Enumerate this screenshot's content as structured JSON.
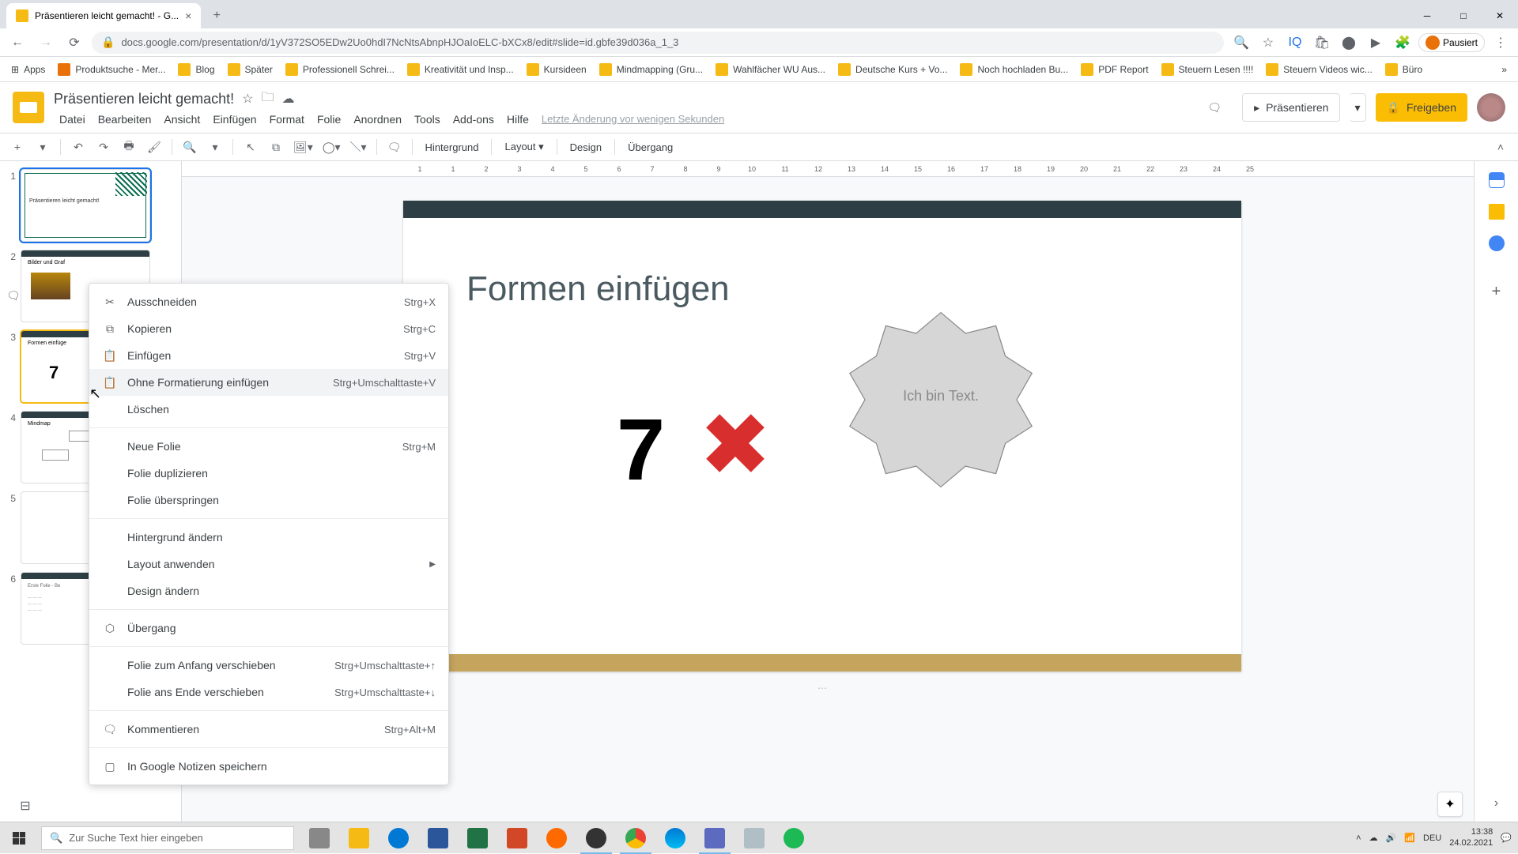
{
  "browser": {
    "tab_title": "Präsentieren leicht gemacht! - G...",
    "url": "docs.google.com/presentation/d/1yV372SO5EDw2Uo0hdI7NcNtsAbnpHJOaIoELC-bXCx8/edit#slide=id.gbfe39d036a_1_3",
    "profile_label": "Pausiert"
  },
  "bookmarks": [
    "Apps",
    "Produktsuche - Mer...",
    "Blog",
    "Später",
    "Professionell Schrei...",
    "Kreativität und Insp...",
    "Kursideen",
    "Mindmapping (Gru...",
    "Wahlfächer WU Aus...",
    "Deutsche Kurs + Vo...",
    "Noch hochladen Bu...",
    "PDF Report",
    "Steuern Lesen !!!!",
    "Steuern Videos wic...",
    "Büro"
  ],
  "doc": {
    "title": "Präsentieren leicht gemacht!",
    "last_edit": "Letzte Änderung vor wenigen Sekunden"
  },
  "menus": [
    "Datei",
    "Bearbeiten",
    "Ansicht",
    "Einfügen",
    "Format",
    "Folie",
    "Anordnen",
    "Tools",
    "Add-ons",
    "Hilfe"
  ],
  "header_buttons": {
    "present": "Präsentieren",
    "share": "Freigeben"
  },
  "toolbar": {
    "background": "Hintergrund",
    "layout": "Layout",
    "design": "Design",
    "transition": "Übergang"
  },
  "ruler_marks": [
    "1",
    "1",
    "2",
    "3",
    "4",
    "5",
    "6",
    "7",
    "8",
    "9",
    "10",
    "11",
    "12",
    "13",
    "14",
    "15",
    "16",
    "17",
    "18",
    "19",
    "20",
    "21",
    "22",
    "23",
    "24",
    "25"
  ],
  "slide": {
    "title": "Formen einfügen",
    "seven": "7",
    "star_text": "Ich bin Text."
  },
  "thumbs": {
    "t1": "Präsentieren leicht gemacht!",
    "t2": "Bilder und Graf",
    "t3": "Formen einfüge",
    "t4": "Mindmap",
    "t6": "Erste Folie - Be"
  },
  "context_menu": {
    "cut": "Ausschneiden",
    "cut_sc": "Strg+X",
    "copy": "Kopieren",
    "copy_sc": "Strg+C",
    "paste": "Einfügen",
    "paste_sc": "Strg+V",
    "paste_plain": "Ohne Formatierung einfügen",
    "paste_plain_sc": "Strg+Umschalttaste+V",
    "delete": "Löschen",
    "new_slide": "Neue Folie",
    "new_slide_sc": "Strg+M",
    "duplicate": "Folie duplizieren",
    "skip": "Folie überspringen",
    "background": "Hintergrund ändern",
    "layout": "Layout anwenden",
    "design": "Design ändern",
    "transition": "Übergang",
    "move_start": "Folie zum Anfang verschieben",
    "move_start_sc": "Strg+Umschalttaste+↑",
    "move_end": "Folie ans Ende verschieben",
    "move_end_sc": "Strg+Umschalttaste+↓",
    "comment": "Kommentieren",
    "comment_sc": "Strg+Alt+M",
    "keep": "In Google Notizen speichern"
  },
  "taskbar": {
    "search_placeholder": "Zur Suche Text hier eingeben",
    "lang": "DEU",
    "time": "13:38",
    "date": "24.02.2021"
  }
}
